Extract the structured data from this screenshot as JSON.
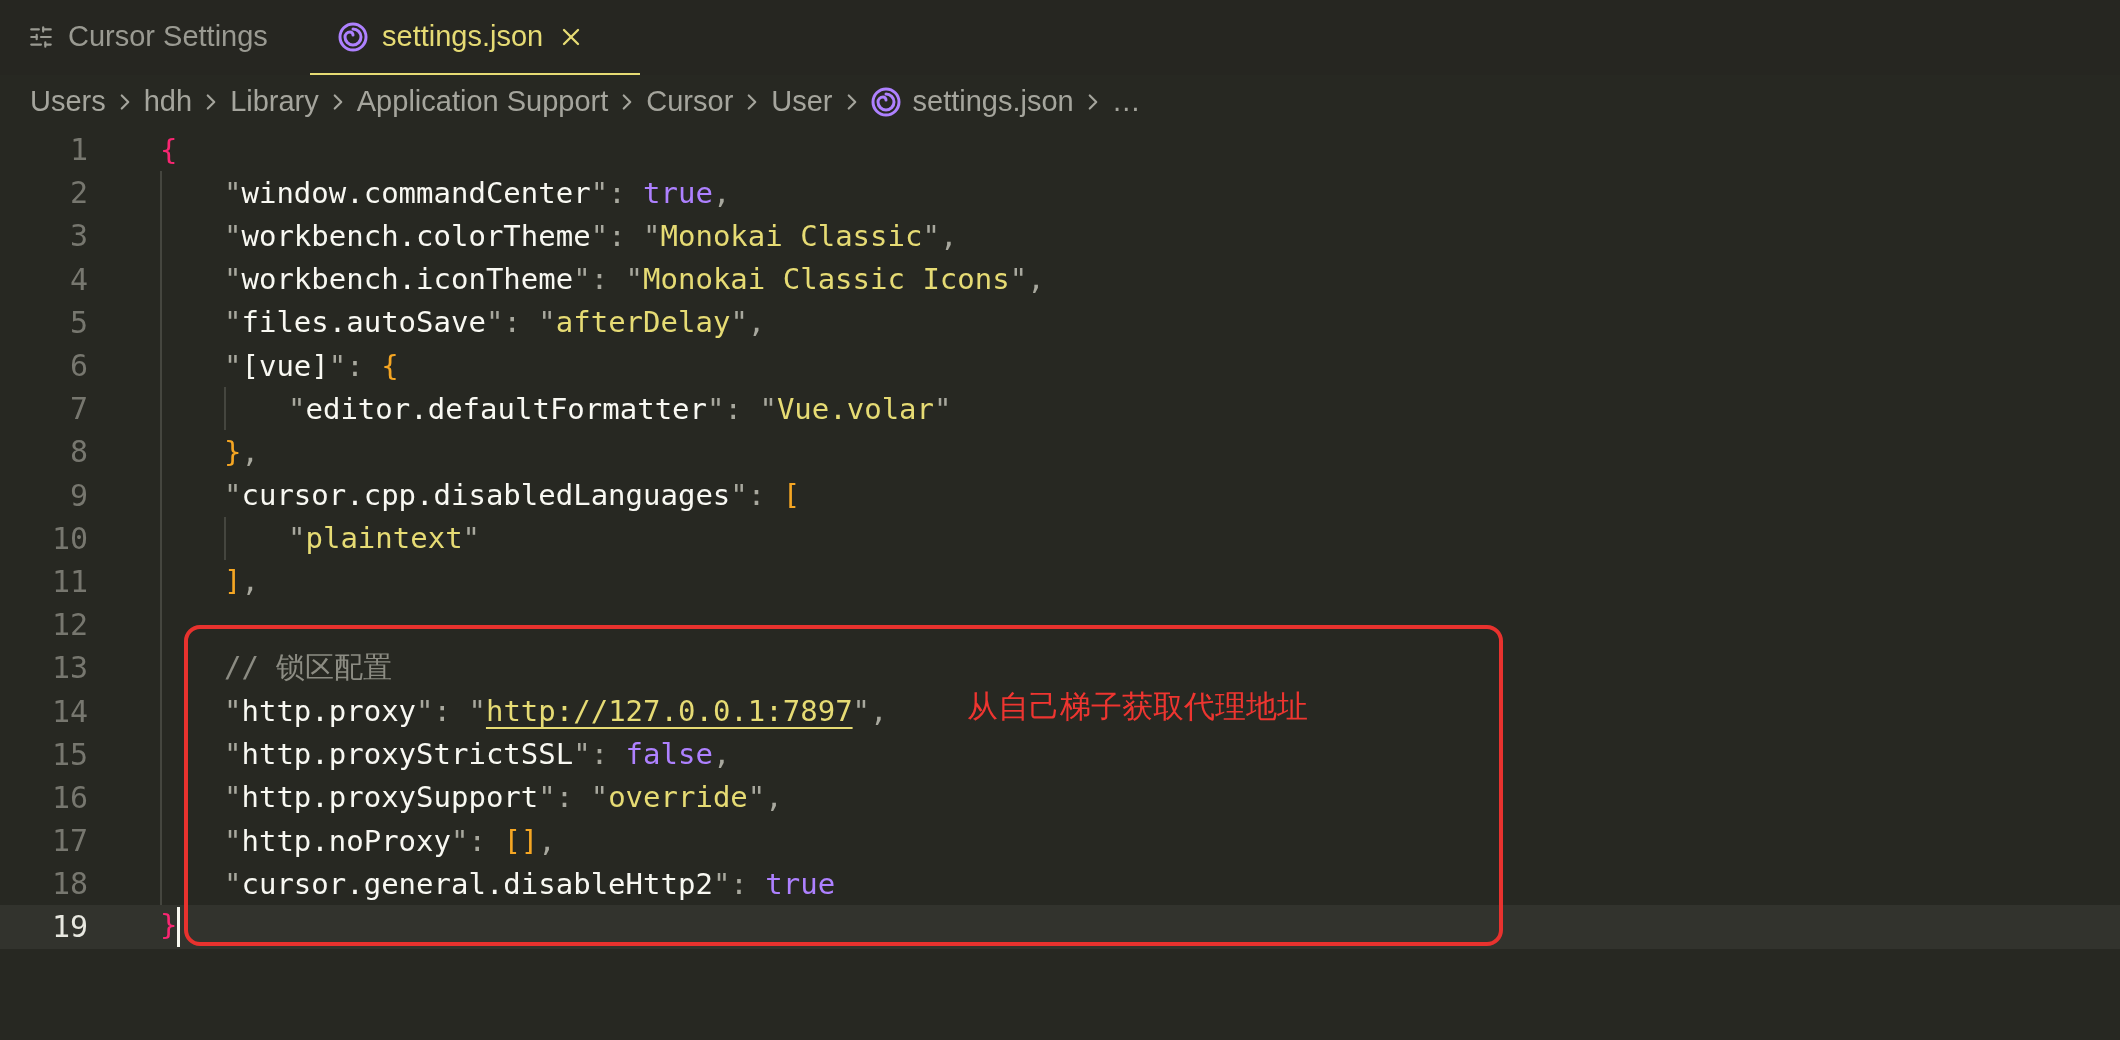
{
  "tabs": [
    {
      "label": "Cursor Settings",
      "kind": "settings",
      "selected": false,
      "closable": false
    },
    {
      "label": "settings.json",
      "kind": "json",
      "selected": true,
      "closable": true
    }
  ],
  "breadcrumb": [
    {
      "label": "Users",
      "kind": "folder"
    },
    {
      "label": "hdh",
      "kind": "folder"
    },
    {
      "label": "Library",
      "kind": "folder"
    },
    {
      "label": "Application Support",
      "kind": "folder"
    },
    {
      "label": "Cursor",
      "kind": "folder"
    },
    {
      "label": "User",
      "kind": "folder"
    },
    {
      "label": "settings.json",
      "kind": "json"
    },
    {
      "label": "…",
      "kind": "more"
    }
  ],
  "lines": [
    {
      "number": "1",
      "current": false,
      "tokens": [
        {
          "kind": "outer-bracket",
          "text": "{"
        }
      ],
      "children": [
        {
          "number": "2",
          "current": false,
          "tokens": [
            {
              "kind": "key",
              "text": "\"window.commandCenter\""
            },
            {
              "kind": "punct",
              "text": ": "
            },
            {
              "kind": "keyword",
              "text": "true"
            },
            {
              "kind": "punct",
              "text": ","
            }
          ]
        },
        {
          "number": "3",
          "current": false,
          "tokens": [
            {
              "kind": "key",
              "text": "\"workbench.colorTheme\""
            },
            {
              "kind": "punct",
              "text": ": "
            },
            {
              "kind": "string",
              "text": "\"Monokai Classic\""
            },
            {
              "kind": "punct",
              "text": ","
            }
          ]
        },
        {
          "number": "4",
          "current": false,
          "tokens": [
            {
              "kind": "key",
              "text": "\"workbench.iconTheme\""
            },
            {
              "kind": "punct",
              "text": ": "
            },
            {
              "kind": "string",
              "text": "\"Monokai Classic Icons\""
            },
            {
              "kind": "punct",
              "text": ","
            }
          ]
        },
        {
          "number": "5",
          "current": false,
          "tokens": [
            {
              "kind": "key",
              "text": "\"files.autoSave\""
            },
            {
              "kind": "punct",
              "text": ": "
            },
            {
              "kind": "string",
              "text": "\"afterDelay\""
            },
            {
              "kind": "punct",
              "text": ","
            }
          ]
        },
        {
          "number": "6",
          "current": false,
          "tokens": [
            {
              "kind": "key",
              "text": "\"[vue]\""
            },
            {
              "kind": "punct",
              "text": ": "
            },
            {
              "kind": "bracket",
              "text": "{"
            }
          ],
          "children": [
            {
              "number": "7",
              "current": false,
              "tokens": [
                {
                  "kind": "key",
                  "text": "\"editor.defaultFormatter\""
                },
                {
                  "kind": "punct",
                  "text": ": "
                },
                {
                  "kind": "string",
                  "text": "\"Vue.volar\""
                }
              ]
            }
          ]
        },
        {
          "number": "8",
          "current": false,
          "tokens": [
            {
              "kind": "bracket",
              "text": "}"
            },
            {
              "kind": "punct",
              "text": ","
            }
          ]
        },
        {
          "number": "9",
          "current": false,
          "tokens": [
            {
              "kind": "key",
              "text": "\"cursor.cpp.disabledLanguages\""
            },
            {
              "kind": "punct",
              "text": ": "
            },
            {
              "kind": "bracket",
              "text": "["
            }
          ],
          "children": [
            {
              "number": "10",
              "current": false,
              "tokens": [
                {
                  "kind": "string",
                  "text": "\"plaintext\""
                }
              ]
            }
          ]
        },
        {
          "number": "11",
          "current": false,
          "tokens": [
            {
              "kind": "bracket",
              "text": "]"
            },
            {
              "kind": "punct",
              "text": ","
            }
          ]
        },
        {
          "number": "12",
          "current": false
        },
        {
          "number": "13",
          "current": false,
          "tokens": [
            {
              "kind": "comment",
              "text": "// 锁区配置"
            }
          ]
        },
        {
          "number": "14",
          "current": false,
          "tokens": [
            {
              "kind": "key",
              "text": "\"http.proxy\""
            },
            {
              "kind": "punct",
              "text": ": "
            },
            {
              "kind": "link",
              "text": "\"http://127.0.0.1:7897\""
            },
            {
              "kind": "punct",
              "text": ","
            }
          ]
        },
        {
          "number": "15",
          "current": false,
          "tokens": [
            {
              "kind": "key",
              "text": "\"http.proxyStrictSSL\""
            },
            {
              "kind": "punct",
              "text": ": "
            },
            {
              "kind": "keyword",
              "text": "false"
            },
            {
              "kind": "punct",
              "text": ","
            }
          ]
        },
        {
          "number": "16",
          "current": false,
          "tokens": [
            {
              "kind": "key",
              "text": "\"http.proxySupport\""
            },
            {
              "kind": "punct",
              "text": ": "
            },
            {
              "kind": "string",
              "text": "\"override\""
            },
            {
              "kind": "punct",
              "text": ","
            }
          ]
        },
        {
          "number": "17",
          "current": false,
          "tokens": [
            {
              "kind": "key",
              "text": "\"http.noProxy\""
            },
            {
              "kind": "punct",
              "text": ": "
            },
            {
              "kind": "bracket",
              "text": "[]"
            },
            {
              "kind": "punct",
              "text": ","
            }
          ]
        },
        {
          "number": "18",
          "current": false,
          "tokens": [
            {
              "kind": "key",
              "text": "\"cursor.general.disableHttp2\""
            },
            {
              "kind": "punct",
              "text": ": "
            },
            {
              "kind": "keyword",
              "text": "true"
            }
          ]
        }
      ]
    },
    {
      "number": "19",
      "current": true,
      "tokens": [
        {
          "kind": "outer-bracket",
          "text": "}"
        }
      ]
    }
  ],
  "annotation": {
    "text": "从自己梯子获取代理地址"
  }
}
